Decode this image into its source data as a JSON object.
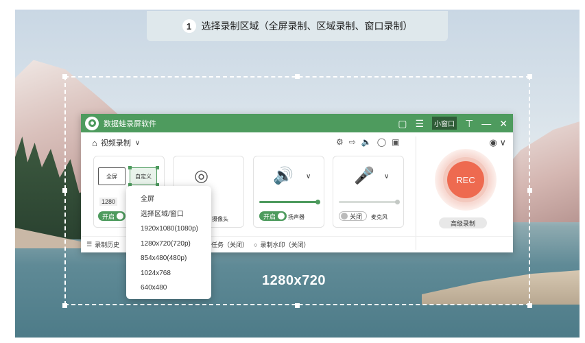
{
  "banner": {
    "step": "1",
    "text": "选择录制区域（全屏录制、区域录制、窗口录制）"
  },
  "selection": {
    "size_label": "1280x720"
  },
  "window": {
    "title": "数据蛙录屏软件",
    "mini_window": "小窗口",
    "mode": "视频录制",
    "region": {
      "fullscreen": "全屏",
      "custom": "自定义",
      "resolution": "1280",
      "toggle": "开启"
    },
    "camera": {
      "label": "摄像头"
    },
    "speaker": {
      "toggle": "开启",
      "label": "扬声器",
      "volume": 1.0
    },
    "mic": {
      "toggle": "关闭",
      "label": "麦克风",
      "volume": 1.0
    },
    "rec_button": "REC",
    "advanced": "高级录制",
    "bottom": {
      "history": "录制历史",
      "task": "任务（关闭）",
      "watermark": "录制水印（关闭）"
    }
  },
  "dropdown": {
    "options": [
      "全屏",
      "选择区域/窗口",
      "1920x1080(1080p)",
      "1280x720(720p)",
      "854x480(480p)",
      "1024x768",
      "640x480"
    ]
  },
  "colors": {
    "brand_green": "#4e9b5e",
    "rec_red": "#ee6a50"
  }
}
